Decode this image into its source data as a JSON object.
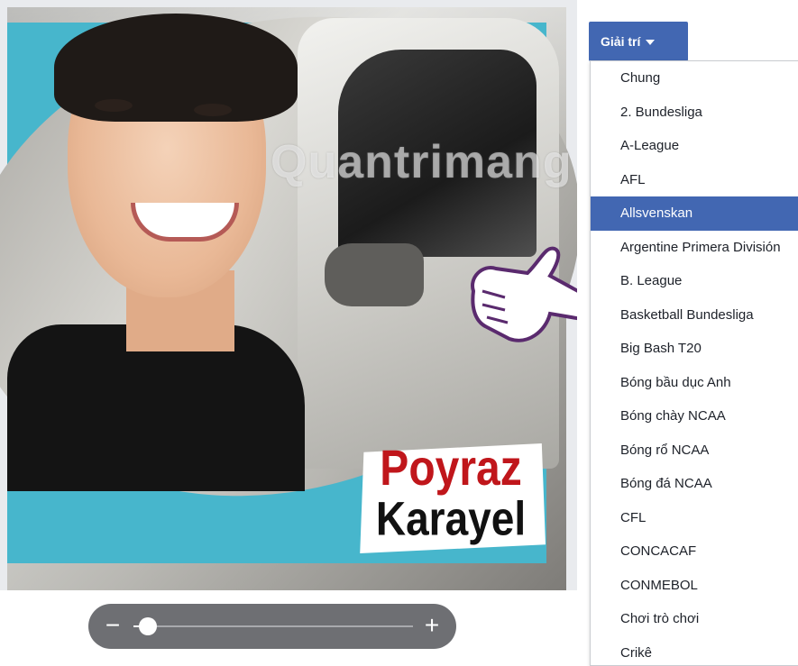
{
  "cover_photo": {
    "watermark": "Quantrimang",
    "frame_sticker": {
      "line1": "Poyraz",
      "line2": "Karayel"
    }
  },
  "zoom": {
    "minus_label": "−",
    "plus_label": "+",
    "level": 0.05
  },
  "category": {
    "button_label": "Giải trí",
    "items": [
      {
        "label": "Chung",
        "selected": false
      },
      {
        "label": "2. Bundesliga",
        "selected": false
      },
      {
        "label": "A-League",
        "selected": false
      },
      {
        "label": "AFL",
        "selected": false
      },
      {
        "label": "Allsvenskan",
        "selected": true
      },
      {
        "label": "Argentine Primera División",
        "selected": false
      },
      {
        "label": "B. League",
        "selected": false
      },
      {
        "label": "Basketball Bundesliga",
        "selected": false
      },
      {
        "label": "Big Bash T20",
        "selected": false
      },
      {
        "label": "Bóng bầu dục Anh",
        "selected": false
      },
      {
        "label": "Bóng chày NCAA",
        "selected": false
      },
      {
        "label": "Bóng rổ NCAA",
        "selected": false
      },
      {
        "label": "Bóng đá NCAA",
        "selected": false
      },
      {
        "label": "CFL",
        "selected": false
      },
      {
        "label": "CONCACAF",
        "selected": false
      },
      {
        "label": "CONMEBOL",
        "selected": false
      },
      {
        "label": "Chơi trò chơi",
        "selected": false
      },
      {
        "label": "Crikê",
        "selected": false
      }
    ]
  },
  "colors": {
    "accent": "#4267b2",
    "frame_cyan": "#47b6cc",
    "sticker_red": "#c0161b",
    "slider_bg": "#6e6f73"
  }
}
